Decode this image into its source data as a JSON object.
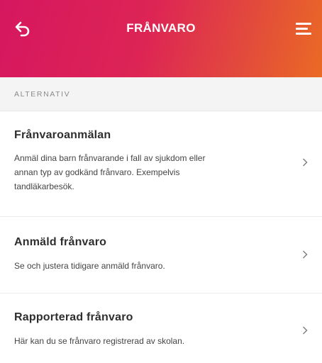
{
  "header": {
    "title": "FRÅNVARO",
    "background_start": "#d6175f",
    "background_end": "#ea6a25",
    "back_icon": "back-arrow-icon",
    "menu_icon": "hamburger-menu-icon"
  },
  "section": {
    "label": "ALTERNATIV"
  },
  "items": [
    {
      "title": "Frånvaroanmälan",
      "desc_lines": [
        "Anmäl dina barn frånvarande i fall av sjukdom eller",
        "annan typ av godkänd frånvaro. Exempelvis",
        "tandläkarbesök."
      ]
    },
    {
      "title": "Anmäld frånvaro",
      "desc_lines": [
        "Se och justera tidigare anmäld frånvaro."
      ]
    },
    {
      "title": "Rapporterad frånvaro",
      "desc_lines": [
        "Här kan du se frånvaro registrerad av skolan."
      ]
    }
  ],
  "chevron_icon": "chevron-right-icon"
}
